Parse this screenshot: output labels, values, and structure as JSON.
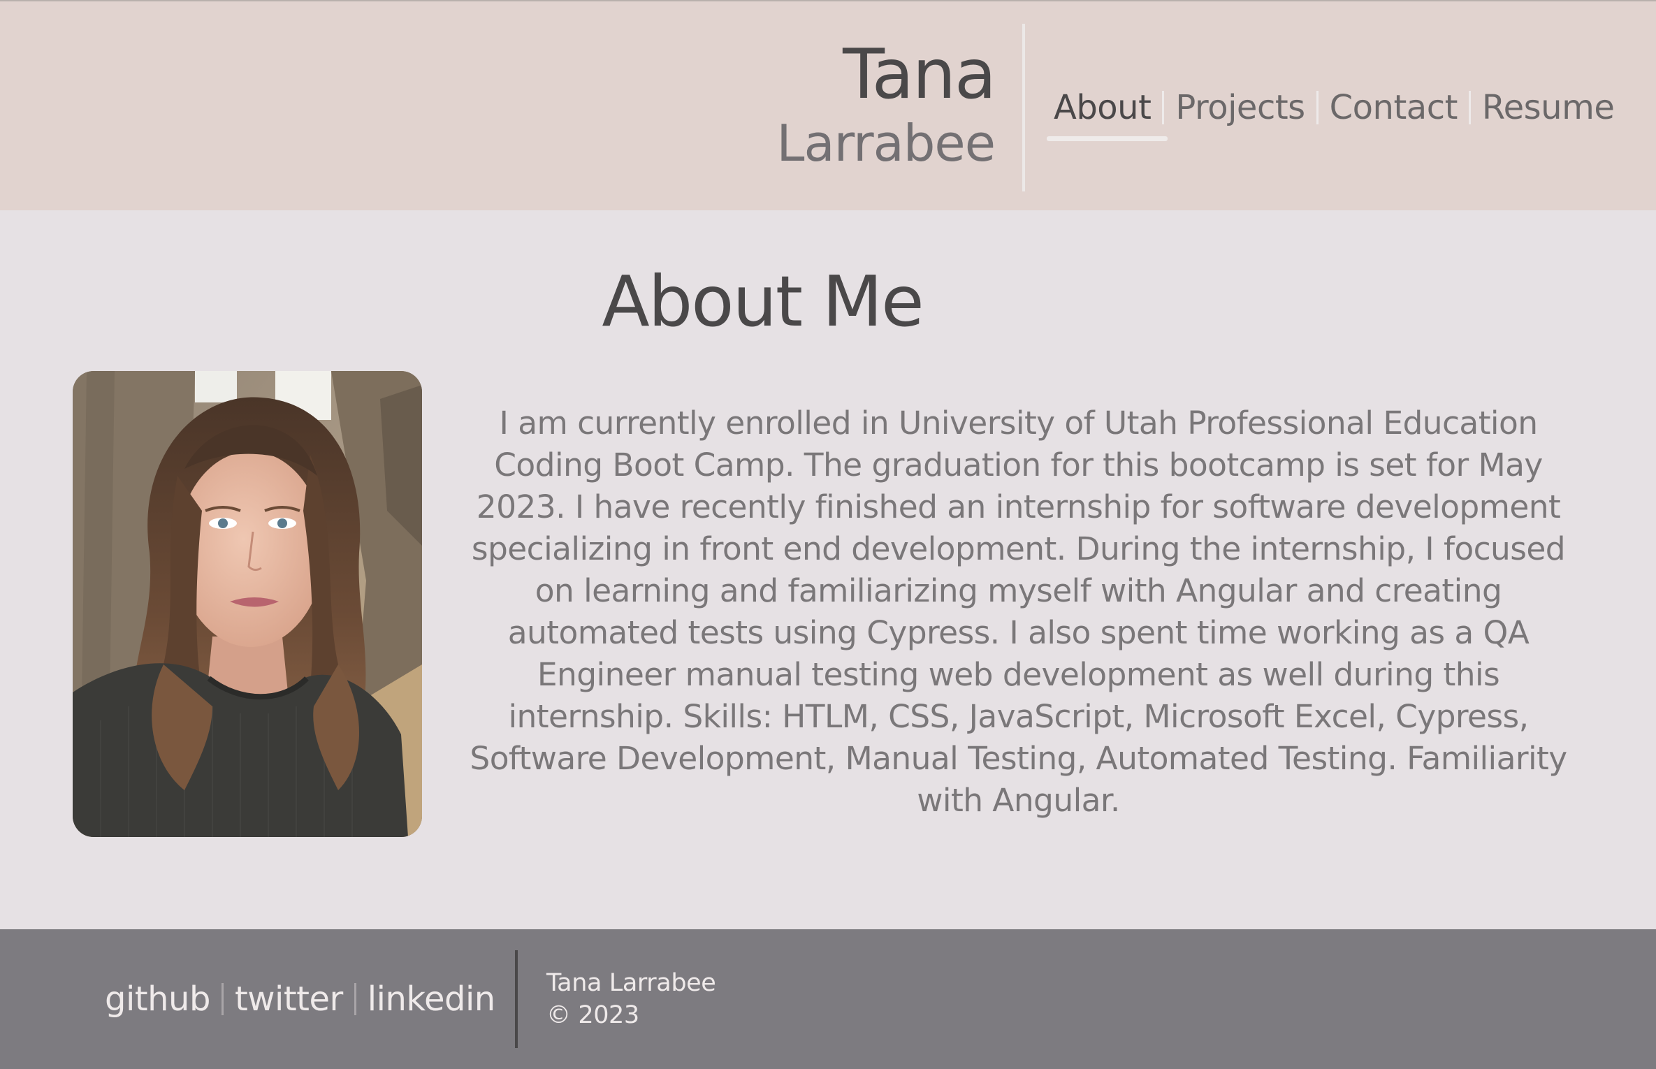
{
  "header": {
    "first_name": "Tana",
    "last_name": "Larrabee",
    "nav": [
      {
        "label": "About",
        "active": true
      },
      {
        "label": "Projects",
        "active": false
      },
      {
        "label": "Contact",
        "active": false
      },
      {
        "label": "Resume",
        "active": false
      }
    ]
  },
  "main": {
    "title": "About Me",
    "bio": "I am currently enrolled in University of Utah Professional Education Coding Boot Camp. The graduation for this bootcamp is set for May 2023. I have recently finished an internship for software development specializing in front end development. During the internship, I focused on learning and familiarizing myself with Angular and creating automated tests using Cypress. I also spent time working as a QA Engineer manual testing web development as well during this internship. Skills: HTLM, CSS, JavaScript, Microsoft Excel, Cypress, Software Development, Manual Testing, Automated Testing. Familiarity with Angular."
  },
  "footer": {
    "links": [
      "github",
      "twitter",
      "linkedin"
    ],
    "owner": "Tana Larrabee",
    "copyright": "© 2023"
  },
  "colors": {
    "header_bg": "#e1d3cf",
    "page_bg": "#e6e1e4",
    "footer_bg": "#7d7b80",
    "heading_text": "#4a4849",
    "body_text": "#7a7779"
  }
}
